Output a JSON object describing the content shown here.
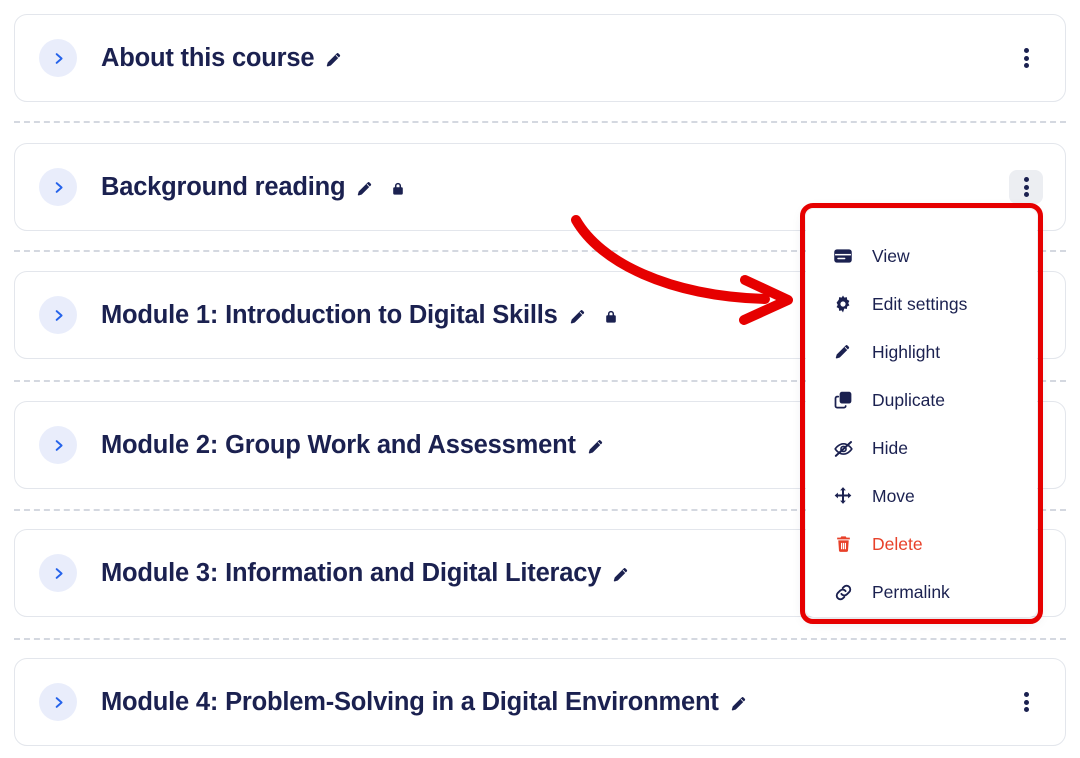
{
  "theme": {
    "page_background": "#ffffff",
    "card_background": "#ffffff",
    "card_border": "#e3e6ec",
    "title_color": "#1b2150",
    "chevron_circle": "#e9edfb",
    "chevron_color": "#2563eb",
    "separator_color": "#d4d8e0",
    "menu_text": "#1b2150",
    "danger_color": "#e8412a",
    "annotation_red": "#e60000",
    "kebab_active_background": "#eceef2"
  },
  "course_sections": [
    {
      "title": "About this course",
      "chevron_icon": "chevron-right-icon",
      "edit_icon": "pencil-icon",
      "has_lock": false,
      "lock_icon": "",
      "kebab_icon": "kebab-menu-icon",
      "kebab_active": false
    },
    {
      "title": "Background reading",
      "chevron_icon": "chevron-right-icon",
      "edit_icon": "pencil-icon",
      "has_lock": true,
      "lock_icon": "lock-icon",
      "kebab_icon": "kebab-menu-icon",
      "kebab_active": true
    },
    {
      "title": "Module 1: Introduction to Digital Skills",
      "chevron_icon": "chevron-right-icon",
      "edit_icon": "pencil-icon",
      "has_lock": true,
      "lock_icon": "lock-icon",
      "kebab_icon": "kebab-menu-icon",
      "kebab_active": false
    },
    {
      "title": "Module 2: Group Work and Assessment",
      "chevron_icon": "chevron-right-icon",
      "edit_icon": "pencil-icon",
      "has_lock": false,
      "lock_icon": "",
      "kebab_icon": "kebab-menu-icon",
      "kebab_active": false
    },
    {
      "title": "Module 3: Information and Digital Literacy",
      "chevron_icon": "chevron-right-icon",
      "edit_icon": "pencil-icon",
      "has_lock": false,
      "lock_icon": "",
      "kebab_icon": "kebab-menu-icon",
      "kebab_active": false
    },
    {
      "title": "Module 4: Problem-Solving in a Digital Environment",
      "chevron_icon": "chevron-right-icon",
      "edit_icon": "pencil-icon",
      "has_lock": false,
      "lock_icon": "",
      "kebab_icon": "kebab-menu-icon",
      "kebab_active": false
    }
  ],
  "action_menu": {
    "open_for_section": "Background reading",
    "items": [
      {
        "label": "View",
        "icon": "view-window-icon",
        "danger": false
      },
      {
        "label": "Edit settings",
        "icon": "gear-icon",
        "danger": false
      },
      {
        "label": "Highlight",
        "icon": "pencil-icon",
        "danger": false
      },
      {
        "label": "Duplicate",
        "icon": "duplicate-icon",
        "danger": false
      },
      {
        "label": "Hide",
        "icon": "eye-slash-icon",
        "danger": false
      },
      {
        "label": "Move",
        "icon": "move-arrows-icon",
        "danger": false
      },
      {
        "label": "Delete",
        "icon": "trash-icon",
        "danger": true
      },
      {
        "label": "Permalink",
        "icon": "link-icon",
        "danger": false
      }
    ]
  },
  "annotations": {
    "highlight_box": {
      "target": "action-menu",
      "color": "#e60000"
    },
    "arrow": {
      "points_to": "action-menu",
      "color": "#e60000",
      "shape": "curved-arrow"
    }
  }
}
